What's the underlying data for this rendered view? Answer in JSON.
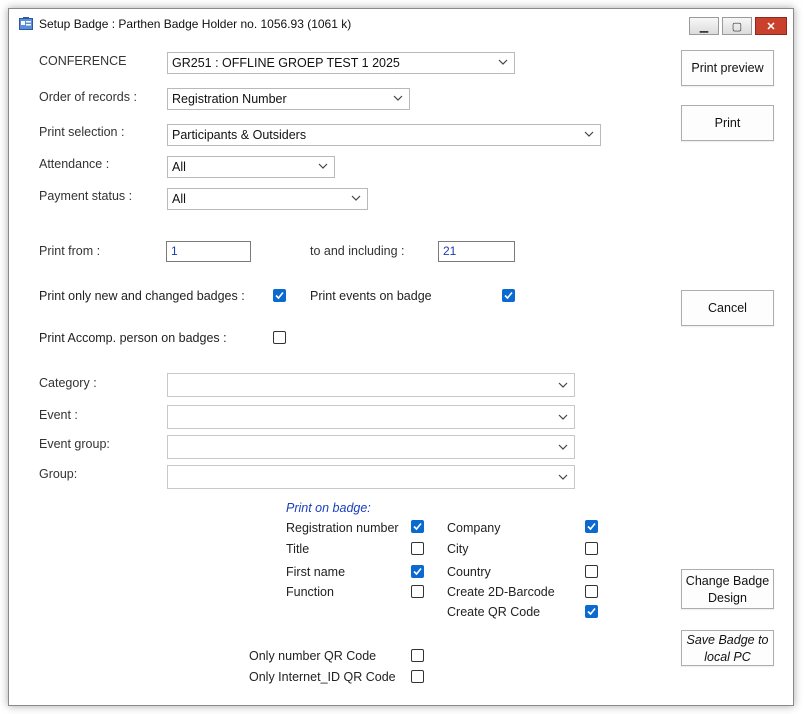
{
  "window": {
    "title": "Setup Badge : Parthen Badge Holder no. 1056.93 (1061 k)"
  },
  "fields": {
    "conference_label": "CONFERENCE",
    "conference_value": "GR251  : OFFLINE GROEP TEST 1   2025",
    "order_label": "Order of records :",
    "order_value": "Registration Number",
    "print_selection_label": "Print selection :",
    "print_selection_value": "Participants & Outsiders",
    "attendance_label": "Attendance :",
    "attendance_value": "All",
    "payment_label": "Payment status :",
    "payment_value": "All",
    "print_from_label": "Print from :",
    "print_from_value": "1",
    "to_label": "to and including :",
    "to_value": "21",
    "only_new_label": "Print only new and changed badges :",
    "events_label": "Print events on badge",
    "accomp_label": "Print Accomp. person on badges :",
    "category_label": "Category :",
    "event_label": "Event :",
    "event_group_label": "Event group:",
    "group_label": "Group:"
  },
  "checks": {
    "only_new": true,
    "events": true,
    "accomp": false
  },
  "print_on_badge": {
    "title": "Print on badge:",
    "left": [
      {
        "label": "Registration number",
        "checked": true
      },
      {
        "label": "Title",
        "checked": false
      },
      {
        "label": "First name",
        "checked": true
      },
      {
        "label": "Function",
        "checked": false
      }
    ],
    "right": [
      {
        "label": "Company",
        "checked": true
      },
      {
        "label": "City",
        "checked": false
      },
      {
        "label": "Country",
        "checked": false
      },
      {
        "label": "Create 2D-Barcode",
        "checked": false
      },
      {
        "label": "Create QR Code",
        "checked": true
      }
    ]
  },
  "qr_options": [
    {
      "label": "Only number QR Code",
      "checked": false
    },
    {
      "label": "Only Internet_ID QR Code",
      "checked": false
    }
  ],
  "buttons": {
    "print_preview": "Print preview",
    "print": "Print",
    "cancel": "Cancel",
    "change_design_1": "Change Badge",
    "change_design_2": "Design",
    "save_local_1": "Save Badge to",
    "save_local_2": "local PC"
  },
  "colors": {
    "accent": "#0a6ad0",
    "section_title": "#1a3fbf",
    "field_text": "#1a3db0"
  }
}
